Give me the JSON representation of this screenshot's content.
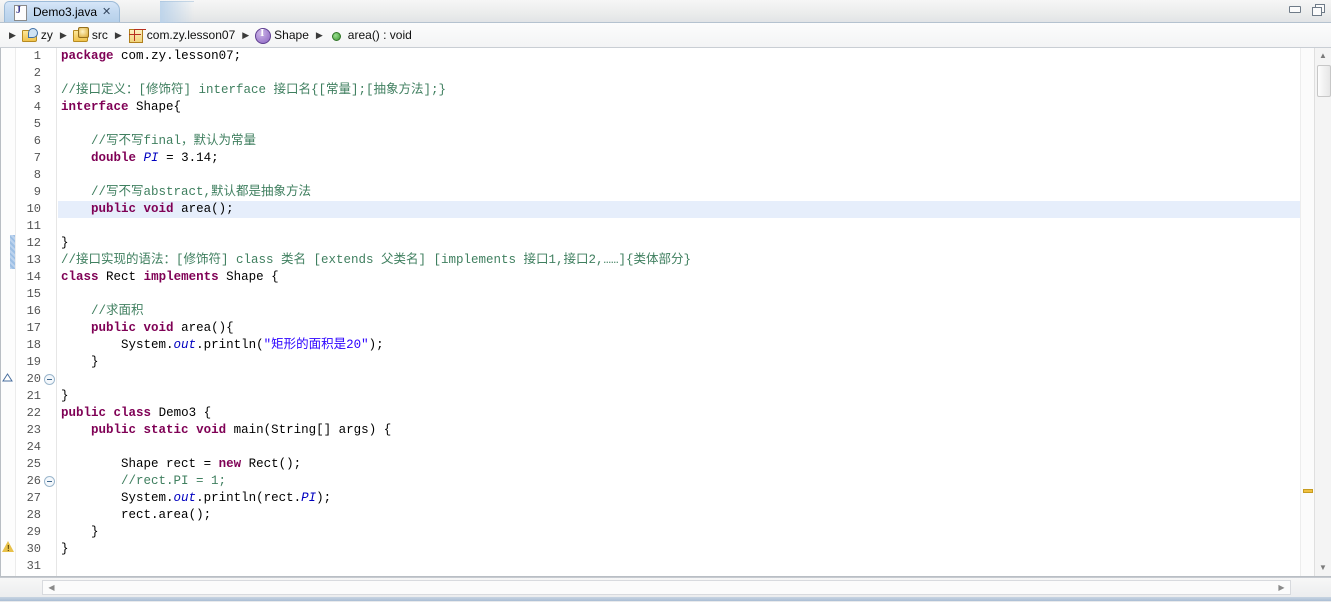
{
  "window": {
    "minimize_label": "Minimize",
    "restore_label": "Restore"
  },
  "tab": {
    "icon": "java-file-icon",
    "title": "Demo3.java",
    "close_glyph": "✕"
  },
  "breadcrumb": {
    "lead_arrow": "▶",
    "items": [
      {
        "icon": "java-project-icon",
        "label": "zy"
      },
      {
        "icon": "source-folder-icon",
        "label": "src"
      },
      {
        "icon": "package-icon",
        "label": "com.zy.lesson07"
      },
      {
        "icon": "interface-icon",
        "label": "Shape"
      },
      {
        "icon": "method-icon",
        "label": "area() : void"
      }
    ],
    "separator": "▶"
  },
  "editor": {
    "current_line": 10,
    "line_numbers": [
      "1",
      "2",
      "3",
      "4",
      "5",
      "6",
      "7",
      "8",
      "9",
      "10",
      "11",
      "12",
      "13",
      "14",
      "15",
      "16",
      "17",
      "18",
      "19",
      "20",
      "21",
      "22",
      "23",
      "24",
      "25",
      "26",
      "27",
      "28",
      "29",
      "30",
      "31"
    ],
    "lines": [
      {
        "n": 1,
        "text": "package com.zy.lesson07;"
      },
      {
        "n": 2,
        "text": ""
      },
      {
        "n": 3,
        "text": "//接口定义：[修饰符] interface 接口名{[常量];[抽象方法];}"
      },
      {
        "n": 4,
        "text": "interface Shape{"
      },
      {
        "n": 5,
        "text": ""
      },
      {
        "n": 6,
        "text": "    //写不写final，默认为常量"
      },
      {
        "n": 7,
        "text": "    double PI = 3.14;"
      },
      {
        "n": 8,
        "text": ""
      },
      {
        "n": 9,
        "text": "    //写不写abstract,默认都是抽象方法"
      },
      {
        "n": 10,
        "text": "    public void area();"
      },
      {
        "n": 11,
        "text": ""
      },
      {
        "n": 12,
        "text": "}"
      },
      {
        "n": 13,
        "text": "//接口实现的语法：[修饰符] class 类名 [extends 父类名] [implements 接口1,接口2,……]{类体部分}"
      },
      {
        "n": 14,
        "text": "class Rect implements Shape {"
      },
      {
        "n": 15,
        "text": ""
      },
      {
        "n": 16,
        "text": "    //求面积"
      },
      {
        "n": 17,
        "text": "    public void area(){"
      },
      {
        "n": 18,
        "text": "        System.out.println(\"矩形的面积是20\");"
      },
      {
        "n": 19,
        "text": "    }"
      },
      {
        "n": 20,
        "text": ""
      },
      {
        "n": 21,
        "text": "}"
      },
      {
        "n": 22,
        "text": "public class Demo3 {"
      },
      {
        "n": 23,
        "text": "    public static void main(String[] args) {"
      },
      {
        "n": 24,
        "text": ""
      },
      {
        "n": 25,
        "text": "        Shape rect = new Rect();"
      },
      {
        "n": 26,
        "text": "        //rect.PI = 1;"
      },
      {
        "n": 27,
        "text": "        System.out.println(rect.PI);"
      },
      {
        "n": 28,
        "text": "        rect.area();"
      },
      {
        "n": 29,
        "text": "    }"
      },
      {
        "n": 30,
        "text": "}"
      },
      {
        "n": 31,
        "text": ""
      }
    ],
    "markers": {
      "warning_line": 27,
      "override_line": 17,
      "change_bar_lines": [
        9,
        10
      ],
      "folding_lines": [
        17,
        23
      ]
    },
    "colors": {
      "keyword": "#7f0055",
      "comment": "#3f7f5f",
      "string": "#2a00ff",
      "field": "#0000c0",
      "text": "#000000",
      "current_line_bg": "#e6eefb",
      "warning": "#f0c040"
    }
  },
  "scrollbars": {
    "vertical": {
      "up_glyph": "▲",
      "down_glyph": "▼"
    },
    "horizontal": {
      "left_glyph": "◀",
      "right_glyph": "▶"
    }
  }
}
